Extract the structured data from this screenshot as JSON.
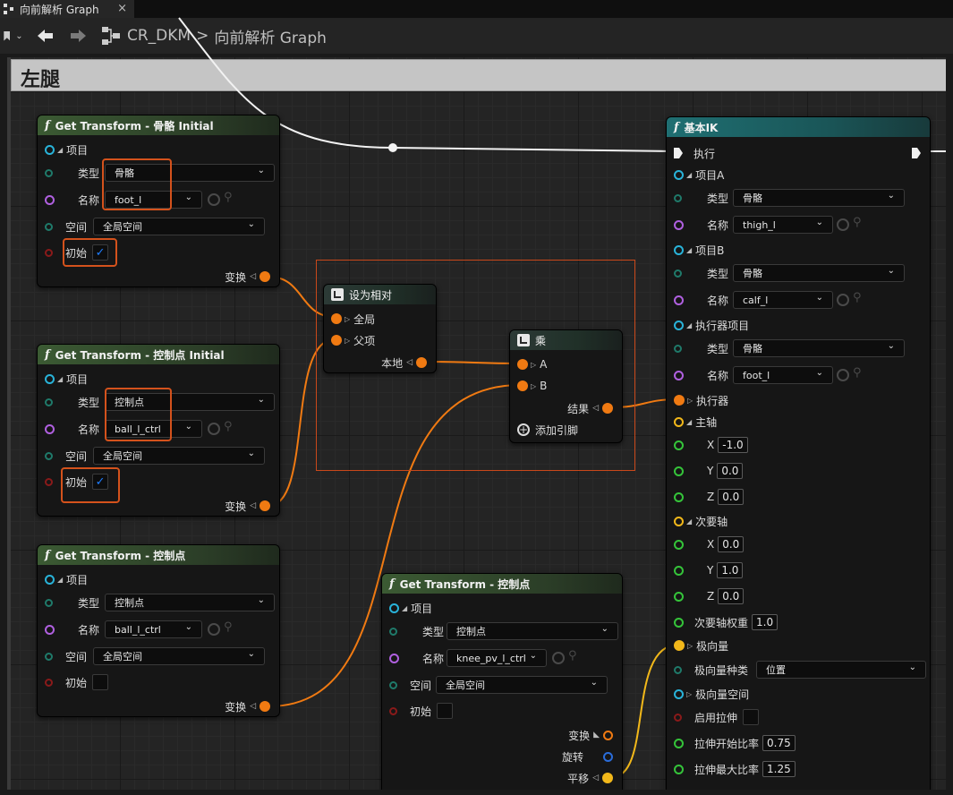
{
  "tab": {
    "title": "向前解析 Graph",
    "close": "×"
  },
  "toolbar": {
    "back": "🡐",
    "forward": "🡒",
    "crumb_root": "CR_DKM",
    "crumb_sep": ">",
    "crumb_leaf": "向前解析 Graph"
  },
  "comment": {
    "title": "左腿"
  },
  "colors": {
    "transform": "#f07a12",
    "item": "#29b3d9",
    "name": "#b060e0",
    "struct": "#2aa8a0",
    "bool": "#9a1a1a",
    "vector": "#f2b81a",
    "float": "#35c43a"
  },
  "node1": {
    "title": "Get Transform - 骨骼 Initial",
    "item": "项目",
    "type_label": "类型",
    "type_value": "骨骼",
    "name_label": "名称",
    "name_value": "foot_l",
    "space_label": "空间",
    "space_value": "全局空间",
    "initial_label": "初始",
    "output": "变换"
  },
  "node2": {
    "title": "Get Transform - 控制点 Initial",
    "item": "项目",
    "type_label": "类型",
    "type_value": "控制点",
    "name_label": "名称",
    "name_value": "ball_l_ctrl",
    "space_label": "空间",
    "space_value": "全局空间",
    "initial_label": "初始",
    "output": "变换"
  },
  "node3": {
    "title": "Get Transform - 控制点",
    "item": "项目",
    "type_label": "类型",
    "type_value": "控制点",
    "name_label": "名称",
    "name_value": "ball_l_ctrl",
    "space_label": "空间",
    "space_value": "全局空间",
    "initial_label": "初始",
    "output": "变换"
  },
  "node4": {
    "title": "Get Transform - 控制点",
    "item": "项目",
    "type_label": "类型",
    "type_value": "控制点",
    "name_label": "名称",
    "name_value": "knee_pv_l_ctrl",
    "space_label": "空间",
    "space_value": "全局空间",
    "initial_label": "初始",
    "out_transform": "变换",
    "out_rotation": "旋转",
    "out_translation": "平移"
  },
  "relative": {
    "title": "设为相对",
    "global": "全局",
    "parent": "父项",
    "local": "本地"
  },
  "multiply": {
    "title": "乘",
    "a": "A",
    "b": "B",
    "result": "结果",
    "add_pin": "添加引脚"
  },
  "ik": {
    "title": "基本IK",
    "exec": "执行",
    "itemA": "项目A",
    "itemA_type": "骨骼",
    "itemA_name": "thigh_l",
    "itemB": "项目B",
    "itemB_type": "骨骼",
    "itemB_name": "calf_l",
    "effItem": "执行器项目",
    "effItem_type": "骨骼",
    "effItem_name": "foot_l",
    "type_label": "类型",
    "name_label": "名称",
    "effector": "执行器",
    "primary": "主轴",
    "px": "-1.0",
    "py": "0.0",
    "pz": "0.0",
    "secondary": "次要轴",
    "sx": "0.0",
    "sy": "1.0",
    "sz": "0.0",
    "x": "X",
    "y": "Y",
    "z": "Z",
    "sec_weight": "次要轴权重",
    "sec_weight_val": "1.0",
    "pole": "极向量",
    "pole_kind": "极向量种类",
    "pole_kind_val": "位置",
    "pole_space": "极向量空间",
    "stretch": "启用拉伸",
    "stretch_start": "拉伸开始比率",
    "stretch_start_val": "0.75",
    "stretch_max": "拉伸最大比率",
    "stretch_max_val": "1.25"
  }
}
